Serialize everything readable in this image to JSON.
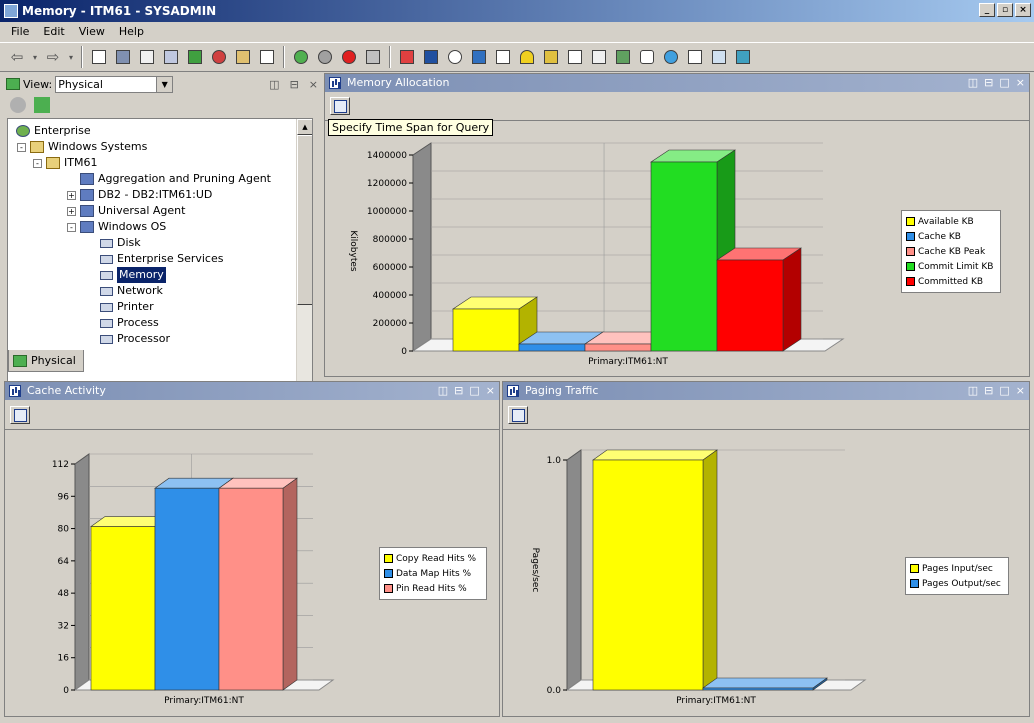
{
  "window": {
    "title": "Memory - ITM61 - SYSADMIN",
    "min": "_",
    "restore": "▫",
    "close": "×"
  },
  "menu": [
    "File",
    "Edit",
    "View",
    "Help"
  ],
  "navigator": {
    "view_label": "View:",
    "view_value": "Physical",
    "tab_label": "Physical",
    "tree": [
      {
        "label": "Enterprise",
        "depth": 0,
        "icon": "globe"
      },
      {
        "label": "Windows Systems",
        "depth": 1,
        "icon": "folder",
        "exp": "-"
      },
      {
        "label": "ITM61",
        "depth": 2,
        "icon": "folder",
        "exp": "-"
      },
      {
        "label": "Aggregation and Pruning Agent",
        "depth": 3,
        "icon": "agent"
      },
      {
        "label": "DB2 - DB2:ITM61:UD",
        "depth": 3,
        "icon": "agent",
        "exp": "+"
      },
      {
        "label": "Universal Agent",
        "depth": 3,
        "icon": "agent",
        "exp": "+"
      },
      {
        "label": "Windows OS",
        "depth": 3,
        "icon": "agent",
        "exp": "-"
      },
      {
        "label": "Disk",
        "depth": 4,
        "icon": "leaf"
      },
      {
        "label": "Enterprise Services",
        "depth": 4,
        "icon": "leaf"
      },
      {
        "label": "Memory",
        "depth": 4,
        "icon": "leaf",
        "selected": true
      },
      {
        "label": "Network",
        "depth": 4,
        "icon": "leaf"
      },
      {
        "label": "Printer",
        "depth": 4,
        "icon": "leaf"
      },
      {
        "label": "Process",
        "depth": 4,
        "icon": "leaf"
      },
      {
        "label": "Processor",
        "depth": 4,
        "icon": "leaf"
      }
    ]
  },
  "tooltip": "Specify Time Span for Query",
  "panels": {
    "memory": {
      "title": "Memory Allocation"
    },
    "cache": {
      "title": "Cache Activity"
    },
    "paging": {
      "title": "Paging Traffic"
    }
  },
  "chart_data": [
    {
      "type": "bar",
      "title": "Memory Allocation",
      "xlabel": "Primary:ITM61:NT",
      "ylabel": "Kilobytes",
      "ylim": [
        0,
        1400000
      ],
      "ticks": [
        "0",
        "200000",
        "400000",
        "600000",
        "800000",
        "1000000",
        "1200000",
        "1400000"
      ],
      "series": [
        {
          "name": "Available KB",
          "values": [
            300000
          ],
          "color": "#ffff00"
        },
        {
          "name": "Cache KB",
          "values": [
            50000
          ],
          "color": "#2f8fe8"
        },
        {
          "name": "Cache KB Peak",
          "values": [
            50000
          ],
          "color": "#ff9088"
        },
        {
          "name": "Commit Limit KB",
          "values": [
            1350000
          ],
          "color": "#22dd22"
        },
        {
          "name": "Committed KB",
          "values": [
            650000
          ],
          "color": "#ff0000"
        }
      ],
      "legend": "right"
    },
    {
      "type": "bar",
      "title": "Cache Activity",
      "xlabel": "Primary:ITM61:NT",
      "ylabel": "",
      "ylim": [
        0,
        112
      ],
      "ticks": [
        "0",
        "16",
        "32",
        "48",
        "64",
        "80",
        "96",
        "112"
      ],
      "series": [
        {
          "name": "Copy Read Hits %",
          "values": [
            81
          ],
          "color": "#ffff00"
        },
        {
          "name": "Data Map Hits %",
          "values": [
            100
          ],
          "color": "#2f8fe8"
        },
        {
          "name": "Pin Read Hits %",
          "values": [
            100
          ],
          "color": "#ff9088"
        }
      ],
      "legend": "right"
    },
    {
      "type": "bar",
      "title": "Paging Traffic",
      "xlabel": "Primary:ITM61:NT",
      "ylabel": "Pages/sec",
      "ylim": [
        0,
        1
      ],
      "ticks": [
        "0.0",
        "1.0"
      ],
      "series": [
        {
          "name": "Pages Input/sec",
          "values": [
            1.0
          ],
          "color": "#ffff00"
        },
        {
          "name": "Pages Output/sec",
          "values": [
            0.0
          ],
          "color": "#2f8fe8"
        }
      ],
      "legend": "right"
    }
  ]
}
